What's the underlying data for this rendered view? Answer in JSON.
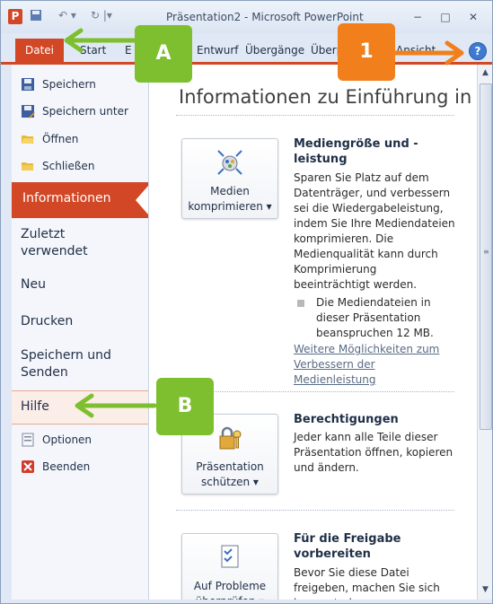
{
  "window": {
    "title": "Präsentation2 - Microsoft PowerPoint",
    "app_icon": "P",
    "controls": [
      "−",
      "□",
      "✕"
    ]
  },
  "ribbon": {
    "file_tab": "Datei",
    "tabs": [
      "Start",
      "E",
      "Entwurf",
      "Übergänge",
      "Überp",
      "Ansicht"
    ],
    "help_icon": "?"
  },
  "nav": {
    "save": "Speichern",
    "save_as": "Speichern unter",
    "open": "Öffnen",
    "close": "Schließen",
    "info": "Informationen",
    "recent": "Zuletzt verwendet",
    "new": "Neu",
    "print": "Drucken",
    "save_send": "Speichern und Senden",
    "help": "Hilfe",
    "options": "Optionen",
    "exit": "Beenden"
  },
  "main": {
    "title": "Informationen zu Einführung in",
    "media": {
      "button": "Medien komprimieren ▾",
      "title": "Mediengröße und -leistung",
      "desc": "Sparen Sie Platz auf dem Datenträger, und verbessern sei die Wiedergabeleistung, indem Sie Ihre Mediendateien komprimieren. Die Medienqualität kann durch Komprimierung beeinträchtigt werden.",
      "bullet": "Die Mediendateien in dieser Präsentation beanspruchen 12 MB.",
      "link": "Weitere Möglichkeiten zum Verbessern der Medienleistung"
    },
    "permissions": {
      "button": "Präsentation schützen ▾",
      "title": "Berechtigungen",
      "desc": "Jeder kann alle Teile dieser Präsentation öffnen, kopieren und ändern."
    },
    "share": {
      "button": "Auf Probleme überprüfen ▾",
      "title": "Für die Freigabe vorbereiten",
      "desc": "Bevor Sie diese Datei freigeben, machen Sie sich bewusst, dass"
    }
  },
  "callouts": {
    "a": "A",
    "b": "B",
    "one": "1"
  },
  "colors": {
    "file_tab": "#d24726",
    "callout_green": "#7dbf2e",
    "callout_orange": "#f07f1c"
  }
}
